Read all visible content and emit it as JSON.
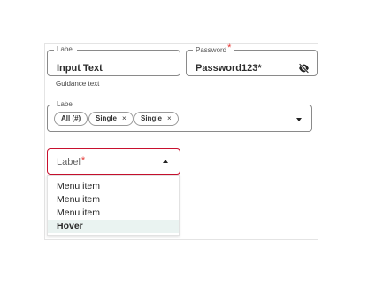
{
  "text_field": {
    "label": "Label",
    "value": "Input Text",
    "helper": "Guidance text"
  },
  "password_field": {
    "label": "Password",
    "required_mark": "*",
    "value": "Password123*",
    "icon": "eye-off-icon"
  },
  "chip_select": {
    "label": "Label",
    "chips": [
      {
        "label": "All (#)",
        "removable": false
      },
      {
        "label": "Single",
        "removable": true,
        "remove_glyph": "×"
      },
      {
        "label": "Single",
        "removable": true,
        "remove_glyph": "×"
      }
    ],
    "icon": "chevron-down-icon"
  },
  "dropdown": {
    "placeholder": "Label",
    "required_mark": "*",
    "icon": "chevron-up-icon",
    "accent_color": "#c8102e",
    "items": [
      {
        "label": "Menu item",
        "state": "default"
      },
      {
        "label": "Menu item",
        "state": "default"
      },
      {
        "label": "Menu item",
        "state": "default"
      },
      {
        "label": "Hover",
        "state": "hover"
      }
    ]
  }
}
